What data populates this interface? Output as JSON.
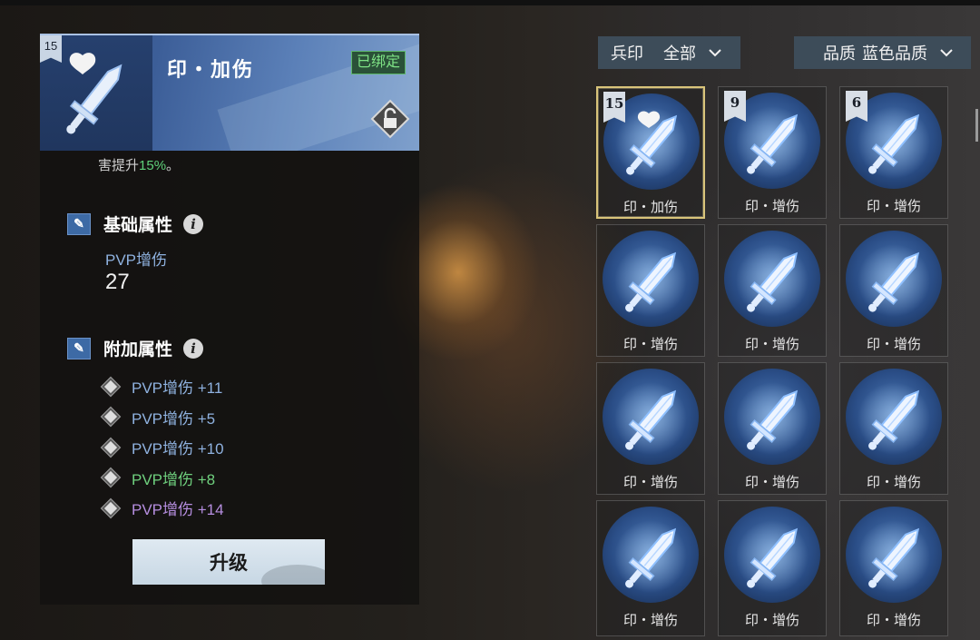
{
  "detail": {
    "level": "15",
    "title": "印・加伤",
    "bound_label": "已绑定",
    "desc_prefix": "害提升",
    "desc_value": "15%",
    "desc_suffix": "。",
    "base_section": "基础属性",
    "base_attr_label": "PVP增伤",
    "base_attr_value": "27",
    "extra_section": "附加属性",
    "extra_attrs": [
      {
        "text": "PVP增伤 +11",
        "color": "#8fb2e0"
      },
      {
        "text": "PVP增伤 +5",
        "color": "#8fb2e0"
      },
      {
        "text": "PVP增伤 +10",
        "color": "#8fb2e0"
      },
      {
        "text": "PVP增伤 +8",
        "color": "#6fd07e"
      },
      {
        "text": "PVP增伤 +14",
        "color": "#b68ee0"
      }
    ],
    "upgrade_label": "升级"
  },
  "filters": {
    "type_label": "兵印",
    "type_value": "全部",
    "quality_label": "品质",
    "quality_value": "蓝色品质"
  },
  "inventory": [
    {
      "label": "印・加伤",
      "level": "15",
      "selected": true,
      "heart": true
    },
    {
      "label": "印・增伤",
      "level": "9"
    },
    {
      "label": "印・增伤",
      "level": "6"
    },
    {
      "label": "印・增伤"
    },
    {
      "label": "印・增伤"
    },
    {
      "label": "印・增伤"
    },
    {
      "label": "印・增伤"
    },
    {
      "label": "印・增伤"
    },
    {
      "label": "印・增伤"
    },
    {
      "label": "印・增伤"
    },
    {
      "label": "印・增伤"
    },
    {
      "label": "印・增伤"
    }
  ],
  "colors": {
    "bound": "#7ee285",
    "selected_border": "#d9c47a",
    "highlight": "#5fd07a"
  },
  "icons": {
    "item": "sword-icon",
    "lock": "lock-icon",
    "info": "info-icon",
    "section": "seal-icon"
  }
}
